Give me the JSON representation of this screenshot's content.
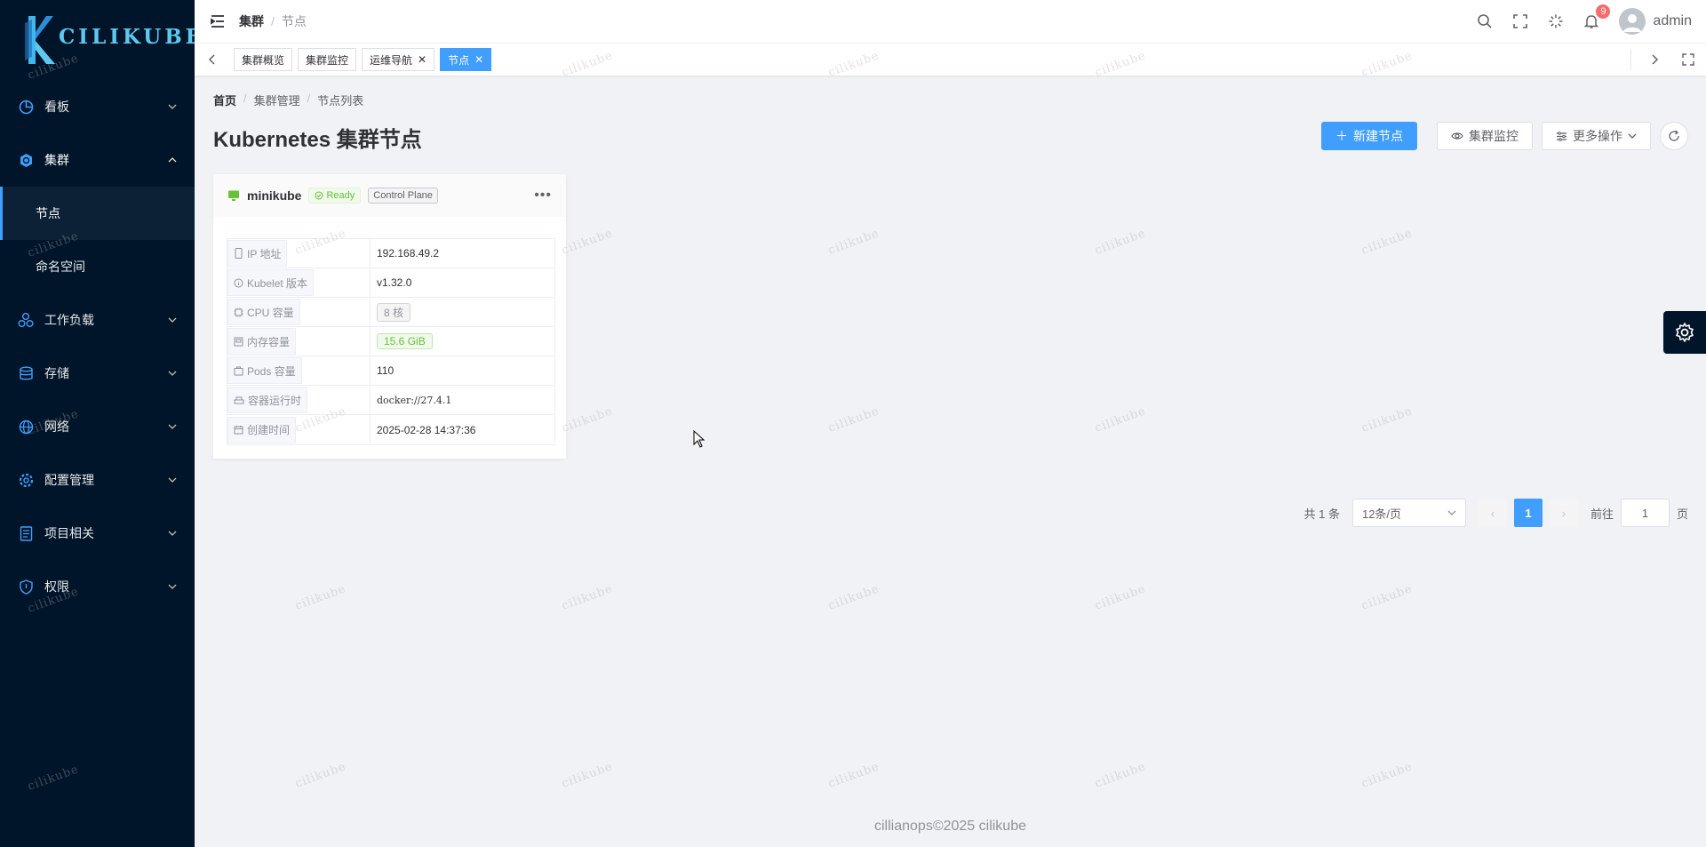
{
  "brand": {
    "logo_text": "CILIKUBE"
  },
  "sidebar": {
    "items": [
      {
        "label": "看板",
        "icon": "dashboard-icon"
      },
      {
        "label": "集群",
        "icon": "kubernetes-icon"
      },
      {
        "label": "工作负载",
        "icon": "workload-icon"
      },
      {
        "label": "存储",
        "icon": "database-icon"
      },
      {
        "label": "网络",
        "icon": "network-icon"
      },
      {
        "label": "配置管理",
        "icon": "config-icon"
      },
      {
        "label": "项目相关",
        "icon": "document-icon"
      },
      {
        "label": "权限",
        "icon": "shield-icon"
      }
    ],
    "cluster_sub": [
      "节点",
      "命名空间"
    ]
  },
  "header": {
    "breadcrumb": [
      "集群",
      "节点"
    ],
    "notification_count": "9",
    "username": "admin"
  },
  "tags": [
    {
      "label": "集群概览",
      "closable": false,
      "active": false
    },
    {
      "label": "集群监控",
      "closable": false,
      "active": false
    },
    {
      "label": "运维导航",
      "closable": true,
      "active": false
    },
    {
      "label": "节点",
      "closable": true,
      "active": true
    }
  ],
  "main": {
    "breadcrumb": [
      "首页",
      "集群管理",
      "节点列表"
    ],
    "title": "Kubernetes 集群节点",
    "actions": {
      "create": "新建节点",
      "monitor": "集群监控",
      "more": "更多操作"
    }
  },
  "node": {
    "name": "minikube",
    "status": "Ready",
    "role": "Control Plane",
    "rows": [
      {
        "label": "IP 地址",
        "value": "192.168.49.2",
        "icon": "phone-icon"
      },
      {
        "label": "Kubelet 版本",
        "value": "v1.32.0",
        "icon": "info-icon"
      },
      {
        "label": "CPU 容量",
        "value": "8 核",
        "icon": "cpu-icon"
      },
      {
        "label": "内存容量",
        "value": "15.6 GiB",
        "icon": "memory-icon"
      },
      {
        "label": "Pods 容量",
        "value": "110",
        "icon": "box-icon"
      },
      {
        "label": "容器运行时",
        "value": "docker://27.4.1",
        "icon": "container-icon"
      },
      {
        "label": "创建时间",
        "value": "2025-02-28 14:37:36",
        "icon": "calendar-icon"
      }
    ]
  },
  "pagination": {
    "total": "共 1 条",
    "page_size": "12条/页",
    "current": "1",
    "goto_prefix": "前往",
    "goto_value": "1",
    "goto_suffix": "页"
  },
  "footer": "cillianops©2025 cilikube",
  "watermark": "cilikube",
  "colors": {
    "sidebar_bg": "#001529",
    "primary": "#409eff",
    "success": "#67c23a",
    "badge": "#f56c6c"
  }
}
